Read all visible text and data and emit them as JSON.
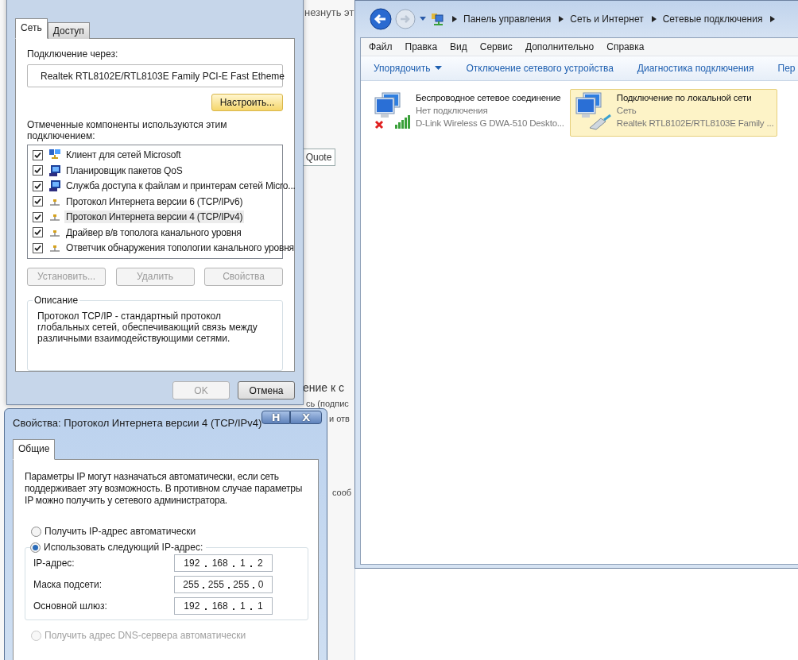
{
  "background_window": {
    "quote_button": "Quote",
    "fragments": [
      "незнуть эт",
      "ение к с",
      "сь (подпис",
      "и отв",
      "сооб"
    ]
  },
  "properties_window": {
    "tabs": [
      {
        "label": "Сеть",
        "selected": true
      },
      {
        "label": "Доступ",
        "selected": false
      }
    ],
    "connect_using_label": "Подключение через:",
    "adapter": "Realtek RTL8102E/RTL8103E Family PCI-E Fast Etheme",
    "configure_button": "Настроить...",
    "components_label": "Отмеченные компоненты используются этим подключением:",
    "components": [
      {
        "label": "Клиент для сетей Microsoft",
        "kind": "client",
        "checked": true,
        "selected": false
      },
      {
        "label": "Планировщик пакетов QoS",
        "kind": "service",
        "checked": true,
        "selected": false
      },
      {
        "label": "Служба доступа к файлам и принтерам сетей Micro...",
        "kind": "service",
        "checked": true,
        "selected": false
      },
      {
        "label": "Протокол Интернета версии 6 (TCP/IPv6)",
        "kind": "protocol",
        "checked": true,
        "selected": false
      },
      {
        "label": "Протокол Интернета версии 4 (TCP/IPv4)",
        "kind": "protocol",
        "checked": true,
        "selected": true
      },
      {
        "label": "Драйвер в/в тополога канального уровня",
        "kind": "protocol",
        "checked": true,
        "selected": false
      },
      {
        "label": "Ответчик обнаружения топологии канального уровня",
        "kind": "protocol",
        "checked": true,
        "selected": false
      }
    ],
    "buttons": [
      {
        "label": "Установить...",
        "disabled": true
      },
      {
        "label": "Удалить",
        "disabled": true
      },
      {
        "label": "Свойства",
        "disabled": true
      }
    ],
    "description": {
      "title": "Описание",
      "text": "Протокол TCP/IP - стандартный протокол глобальных сетей, обеспечивающий связь между различными взаимодействующими сетями."
    },
    "footer_buttons": [
      {
        "label": "OK",
        "disabled": true
      },
      {
        "label": "Отмена",
        "disabled": false
      }
    ]
  },
  "ipv4_window": {
    "title": "Свойства: Протокол Интернета версии 4 (TCP/IPv4)",
    "title_buttons": [
      "H",
      "X"
    ],
    "tabs": [
      {
        "label": "Общие",
        "selected": true
      }
    ],
    "intro": "Параметры IP могут назначаться автоматически, если сеть поддерживает эту возможность. В противном случае параметры IP можно получить у сетевого администратора.",
    "ip_options": [
      {
        "label": "Получить IP-адрес автоматически",
        "selected": false
      },
      {
        "label": "Использовать следующий IP-адрес:",
        "selected": true
      }
    ],
    "fields": [
      {
        "label": "IP-адрес:",
        "octets": [
          "192",
          "168",
          "1",
          "2"
        ]
      },
      {
        "label": "Маска подсети:",
        "octets": [
          "255",
          "255",
          "255",
          "0"
        ]
      },
      {
        "label": "Основной шлюз:",
        "octets": [
          "192",
          "168",
          "1",
          "1"
        ]
      }
    ],
    "dns_options": [
      {
        "label": "Получить адрес DNS-сервера автоматически",
        "selected": false,
        "disabled": true
      }
    ]
  },
  "explorer": {
    "breadcrumb": [
      "Панель управления",
      "Сеть и Интернет",
      "Сетевые подключения"
    ],
    "menu": [
      "Файл",
      "Правка",
      "Вид",
      "Сервис",
      "Дополнительно",
      "Справка"
    ],
    "toolbar": [
      {
        "label": "Упорядочить",
        "dropdown": true
      },
      {
        "label": "Отключение сетевого устройства",
        "dropdown": false
      },
      {
        "label": "Диагностика подключения",
        "dropdown": false
      },
      {
        "label": "Пер",
        "dropdown": false
      }
    ],
    "connections": [
      {
        "name": "Беспроводное сетевое соединение",
        "status": "Нет подключения",
        "device": "D-Link Wireless G DWA-510 Deskto...",
        "kind": "wireless",
        "selected": false
      },
      {
        "name": "Подключение по локальной сети",
        "status": "Сеть",
        "device": "Realtek RTL8102E/RTL8103E Family ...",
        "kind": "wired",
        "selected": true
      }
    ]
  }
}
